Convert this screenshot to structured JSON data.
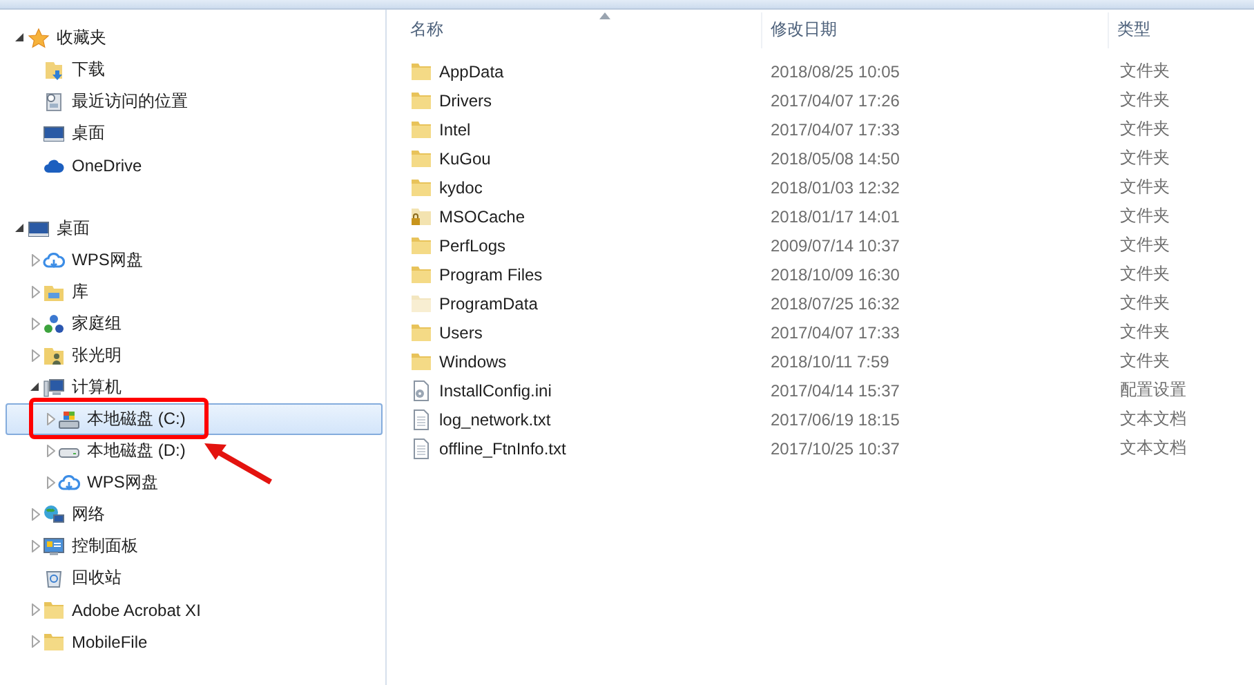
{
  "navigation": {
    "tree": [
      {
        "label": "收藏夹",
        "kind": "star",
        "expanded": true,
        "children": [
          {
            "label": "下载",
            "kind": "download"
          },
          {
            "label": "最近访问的位置",
            "kind": "recent"
          },
          {
            "label": "桌面",
            "kind": "desktop"
          },
          {
            "label": "OneDrive",
            "kind": "cloud"
          }
        ]
      },
      {
        "label": "桌面",
        "kind": "desktop",
        "expanded": true,
        "children": [
          {
            "label": "WPS网盘",
            "kind": "wps",
            "expanded": false
          },
          {
            "label": "库",
            "kind": "library",
            "expanded": false
          },
          {
            "label": "家庭组",
            "kind": "homegroup",
            "expanded": false
          },
          {
            "label": "张光明",
            "kind": "user",
            "expanded": false
          },
          {
            "label": "计算机",
            "kind": "computer",
            "expanded": true,
            "children": [
              {
                "label": "本地磁盘 (C:)",
                "kind": "systemdrive",
                "expanded": false,
                "selected": true,
                "highlighted": true,
                "pointed": false
              },
              {
                "label": "本地磁盘 (D:)",
                "kind": "drive",
                "expanded": false,
                "selected": false,
                "highlighted": false,
                "pointed": true
              },
              {
                "label": "WPS网盘",
                "kind": "wps",
                "expanded": false,
                "selected": false,
                "highlighted": false,
                "pointed": false
              }
            ]
          },
          {
            "label": "网络",
            "kind": "network",
            "expanded": false
          },
          {
            "label": "控制面板",
            "kind": "controlpanel",
            "expanded": false
          },
          {
            "label": "回收站",
            "kind": "recycle"
          },
          {
            "label": "Adobe Acrobat XI",
            "kind": "folder",
            "expanded": false
          },
          {
            "label": "MobileFile",
            "kind": "folder",
            "expanded": false
          }
        ]
      }
    ]
  },
  "file_list": {
    "columns": [
      "名称",
      "修改日期",
      "类型"
    ],
    "rows": [
      {
        "name": "AppData",
        "date": "2018/08/25 10:05",
        "type": "文件夹",
        "kind": "folder"
      },
      {
        "name": "Drivers",
        "date": "2017/04/07 17:26",
        "type": "文件夹",
        "kind": "folder"
      },
      {
        "name": "Intel",
        "date": "2017/04/07 17:33",
        "type": "文件夹",
        "kind": "folder"
      },
      {
        "name": "KuGou",
        "date": "2018/05/08 14:50",
        "type": "文件夹",
        "kind": "folder"
      },
      {
        "name": "kydoc",
        "date": "2018/01/03 12:32",
        "type": "文件夹",
        "kind": "folder"
      },
      {
        "name": "MSOCache",
        "date": "2018/01/17 14:01",
        "type": "文件夹",
        "kind": "locked"
      },
      {
        "name": "PerfLogs",
        "date": "2009/07/14 10:37",
        "type": "文件夹",
        "kind": "folder"
      },
      {
        "name": "Program Files",
        "date": "2018/10/09 16:30",
        "type": "文件夹",
        "kind": "folder"
      },
      {
        "name": "ProgramData",
        "date": "2018/07/25 16:32",
        "type": "文件夹",
        "kind": "hidden"
      },
      {
        "name": "Users",
        "date": "2017/04/07 17:33",
        "type": "文件夹",
        "kind": "folder"
      },
      {
        "name": "Windows",
        "date": "2018/10/11 7:59",
        "type": "文件夹",
        "kind": "folder"
      },
      {
        "name": "InstallConfig.ini",
        "date": "2017/04/14 15:37",
        "type": "配置设置",
        "kind": "config"
      },
      {
        "name": "log_network.txt",
        "date": "2017/06/19 18:15",
        "type": "文本文档",
        "kind": "text"
      },
      {
        "name": "offline_FtnInfo.txt",
        "date": "2017/10/25 10:37",
        "type": "文本文档",
        "kind": "text"
      }
    ]
  }
}
